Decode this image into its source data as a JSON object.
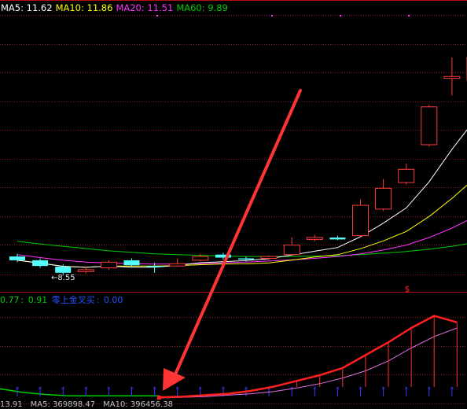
{
  "colors": {
    "background": "#000000",
    "grid": "#8b1a1a",
    "up_candle": "#ff3b3b",
    "down_candle": "#54ffff",
    "ma5": "#ffffff",
    "ma10": "#ffff00",
    "ma20": "#ff33ff",
    "ma60": "#00cc00",
    "signal": "#ff2020",
    "arrow": "#ff3535",
    "blue_marker": "#3a3aff",
    "indicator_label": "#2255ff"
  },
  "ma_legend": [
    {
      "label": "MA5: 11.62",
      "color": "#ffffff"
    },
    {
      "label": "MA10: 11.86",
      "color": "#ffff00"
    },
    {
      "label": "MA20: 11.51",
      "color": "#ff33ff"
    },
    {
      "label": "MA60: 9.89",
      "color": "#00cc00"
    }
  ],
  "low_price_label": "8.55",
  "indicator_legend": {
    "value_a": "0.77",
    "value_b": "0.91",
    "signal_name": "零上金叉买",
    "signal_value": "0.00"
  },
  "bottom_labels": [
    "13.91",
    "MA5: 369898.47",
    "MA10: 396456.38"
  ],
  "signal_marker": "$",
  "candles": [
    {
      "o": 9.05,
      "c": 8.95,
      "h": 9.12,
      "l": 8.9,
      "up": false
    },
    {
      "o": 8.95,
      "c": 8.8,
      "h": 9.0,
      "l": 8.75,
      "up": false
    },
    {
      "o": 8.78,
      "c": 8.62,
      "h": 8.85,
      "l": 8.55,
      "up": false
    },
    {
      "o": 8.65,
      "c": 8.7,
      "h": 8.78,
      "l": 8.6,
      "up": true
    },
    {
      "o": 8.75,
      "c": 8.9,
      "h": 8.95,
      "l": 8.7,
      "up": true
    },
    {
      "o": 8.95,
      "c": 8.82,
      "h": 9.0,
      "l": 8.78,
      "up": false
    },
    {
      "o": 8.8,
      "c": 8.8,
      "h": 8.88,
      "l": 8.62,
      "up": false
    },
    {
      "o": 8.8,
      "c": 8.86,
      "h": 9.0,
      "l": 8.78,
      "up": true
    },
    {
      "o": 8.95,
      "c": 9.05,
      "h": 9.12,
      "l": 8.92,
      "up": true
    },
    {
      "o": 9.1,
      "c": 9.02,
      "h": 9.15,
      "l": 8.96,
      "up": false
    },
    {
      "o": 9.0,
      "c": 8.98,
      "h": 9.05,
      "l": 8.92,
      "up": false
    },
    {
      "o": 9.0,
      "c": 9.05,
      "h": 9.08,
      "l": 8.96,
      "up": true
    },
    {
      "o": 9.1,
      "c": 9.35,
      "h": 9.55,
      "l": 9.08,
      "up": true
    },
    {
      "o": 9.5,
      "c": 9.55,
      "h": 9.62,
      "l": 9.45,
      "up": true
    },
    {
      "o": 9.55,
      "c": 9.5,
      "h": 9.6,
      "l": 9.48,
      "up": false
    },
    {
      "o": 9.6,
      "c": 10.4,
      "h": 10.55,
      "l": 9.55,
      "up": true
    },
    {
      "o": 10.3,
      "c": 10.85,
      "h": 11.1,
      "l": 10.25,
      "up": true
    },
    {
      "o": 11.0,
      "c": 11.35,
      "h": 11.5,
      "l": 10.95,
      "up": true
    },
    {
      "o": 12.0,
      "c": 13.0,
      "h": 13.05,
      "l": 11.95,
      "up": true
    },
    {
      "o": 13.75,
      "c": 13.8,
      "h": 14.3,
      "l": 13.3,
      "up": true
    },
    {
      "o": 13.7,
      "c": 14.3,
      "h": 15.3,
      "l": 13.6,
      "up": true
    }
  ],
  "indicator": {
    "ymax": 1.3,
    "thick": [
      0.01,
      0.02,
      0.04,
      0.06,
      0.1,
      0.16,
      0.24,
      0.32,
      0.42,
      0.6,
      0.78,
      0.98,
      1.15,
      1.06
    ],
    "thin": [
      0.0,
      0.01,
      0.02,
      0.04,
      0.06,
      0.09,
      0.14,
      0.2,
      0.28,
      0.38,
      0.52,
      0.7,
      0.86,
      0.98
    ],
    "green": [
      0.13,
      0.08,
      0.05,
      0.03,
      0.03,
      0.03,
      0.03,
      0.03
    ]
  }
}
